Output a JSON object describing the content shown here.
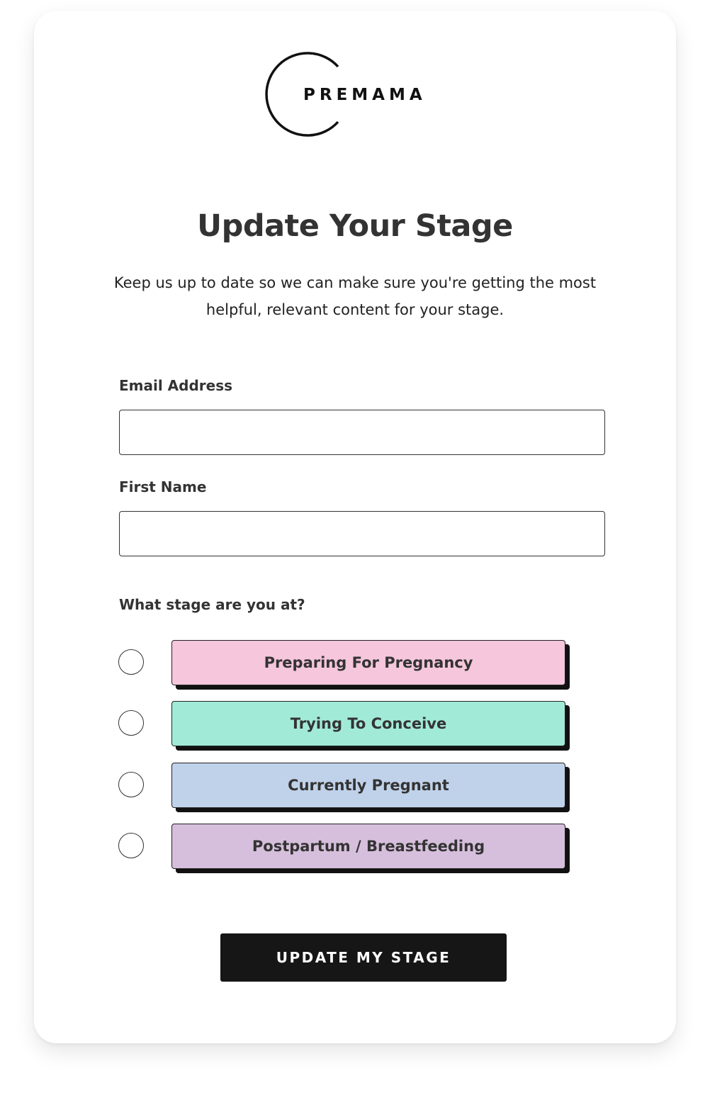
{
  "brand": {
    "logo_text": "PREMAMA"
  },
  "header": {
    "title": "Update Your Stage",
    "subtitle": "Keep us up to date so we can make sure you're getting the most helpful, relevant content for your stage."
  },
  "form": {
    "email": {
      "label": "Email Address",
      "value": "",
      "placeholder": ""
    },
    "first_name": {
      "label": "First Name",
      "value": "",
      "placeholder": ""
    },
    "stage": {
      "label": "What stage are you at?",
      "options": [
        {
          "label": "Preparing For Pregnancy",
          "color": "#f5c6dc",
          "selected": false
        },
        {
          "label": "Trying To Conceive",
          "color": "#a2ead8",
          "selected": false
        },
        {
          "label": "Currently Pregnant",
          "color": "#c0d2ea",
          "selected": false
        },
        {
          "label": "Postpartum / Breastfeeding",
          "color": "#d6bfdc",
          "selected": false
        }
      ]
    },
    "submit_label": "UPDATE MY STAGE"
  }
}
